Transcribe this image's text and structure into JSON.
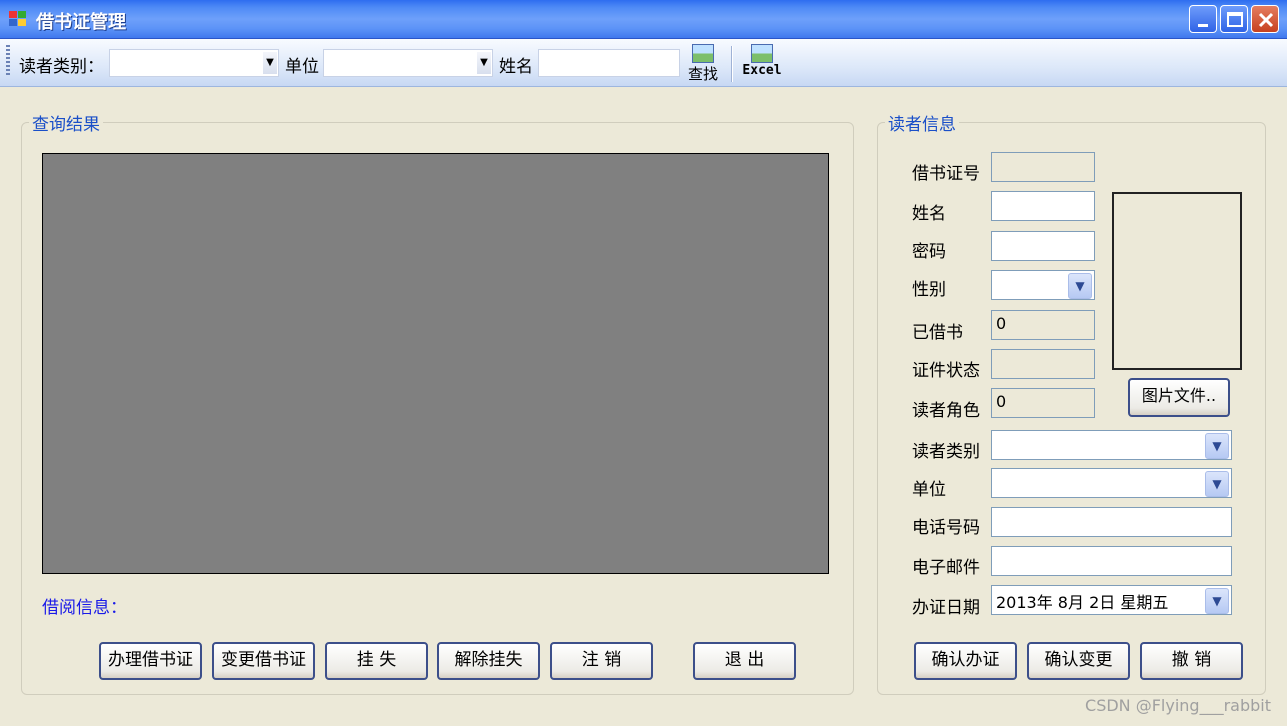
{
  "window": {
    "title": "借书证管理"
  },
  "toolbar": {
    "reader_type_label": "读者类别：",
    "unit_label": "单位",
    "name_label": "姓名",
    "reader_type_value": "",
    "unit_value": "",
    "name_value": "",
    "search_label": "查找",
    "excel_label": "Excel"
  },
  "query": {
    "title": "查询结果",
    "borrow_info_label": "借阅信息："
  },
  "actions": {
    "issue": "办理借书证",
    "change": "变更借书证",
    "report_loss": "挂 失",
    "cancel_loss": "解除挂失",
    "revoke": "注 销",
    "exit": "退 出"
  },
  "reader": {
    "title": "读者信息",
    "card_no_label": "借书证号",
    "name_label": "姓名",
    "password_label": "密码",
    "gender_label": "性别",
    "borrowed_label": "已借书",
    "borrowed_value": "0",
    "status_label": "证件状态",
    "role_label": "读者角色",
    "role_value": "0",
    "category_label": "读者类别",
    "unit_label": "单位",
    "phone_label": "电话号码",
    "email_label": "电子邮件",
    "date_label": "办证日期",
    "date_value": "2013年 8月 2日 星期五",
    "photo_button": "图片文件..",
    "confirm_issue": "确认办证",
    "confirm_change": "确认变更",
    "undo": "撤 销"
  },
  "watermark": "CSDN @Flying___rabbit"
}
